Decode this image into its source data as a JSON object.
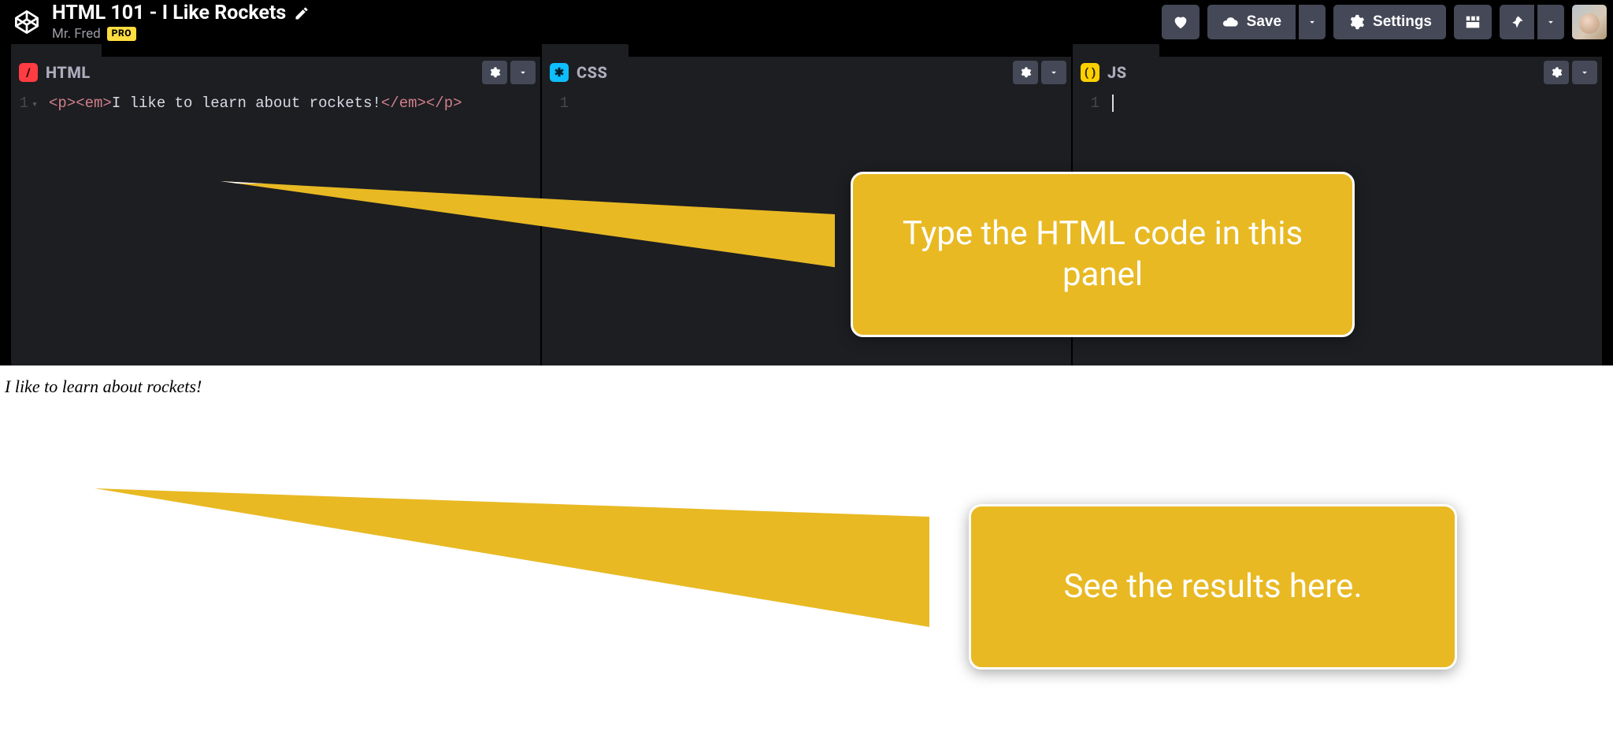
{
  "header": {
    "pen_title": "HTML 101 - I Like Rockets",
    "author": "Mr. Fred",
    "pro_badge": "PRO",
    "save_label": "Save",
    "settings_label": "Settings"
  },
  "panels": {
    "html": {
      "label": "HTML",
      "line_number": "1",
      "code_open1": "<p>",
      "code_open2": "<em>",
      "code_text": "I like to learn about rockets!",
      "code_close2": "</em>",
      "code_close1": "</p>"
    },
    "css": {
      "label": "CSS",
      "line_number": "1"
    },
    "js": {
      "label": "JS",
      "line_number": "1"
    }
  },
  "preview": {
    "output_text": "I like to learn about rockets!"
  },
  "callouts": {
    "editor": "Type the HTML code in this panel",
    "preview": "See the results here."
  }
}
